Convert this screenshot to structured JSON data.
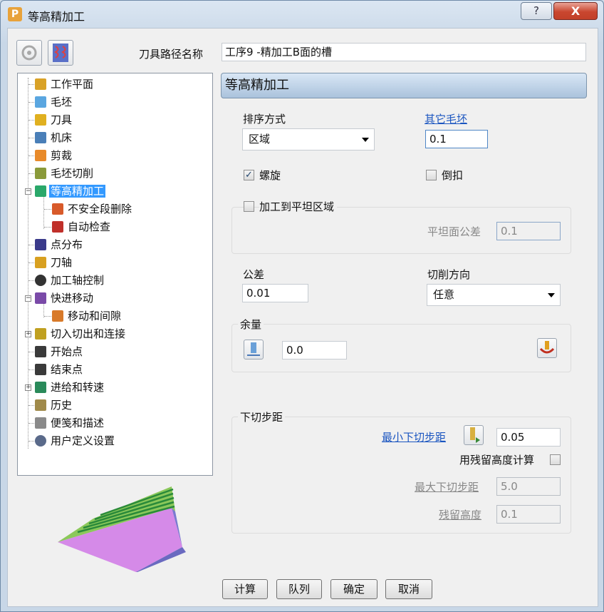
{
  "window": {
    "title": "等高精加工",
    "help": "?",
    "close": "X"
  },
  "header": {
    "path_name_label": "刀具路径名称",
    "path_name_value": "工序9 -精加工B面的槽"
  },
  "tree": {
    "items": [
      {
        "label": "工作平面",
        "color": "#d9a227"
      },
      {
        "label": "毛坯",
        "color": "#5aa6e0"
      },
      {
        "label": "刀具",
        "color": "#e0b020"
      },
      {
        "label": "机床",
        "color": "#4a7fb8"
      },
      {
        "label": "剪裁",
        "color": "#e88a2a"
      },
      {
        "label": "毛坯切削",
        "color": "#8a9a3a"
      },
      {
        "label": "等高精加工",
        "color": "#2aa86a"
      },
      {
        "label": "不安全段删除",
        "color": "#d85a2a"
      },
      {
        "label": "自动检查",
        "color": "#c0302a"
      },
      {
        "label": "点分布",
        "color": "#3a3a8a"
      },
      {
        "label": "刀轴",
        "color": "#d8a020"
      },
      {
        "label": "加工轴控制",
        "color": "#333333"
      },
      {
        "label": "快进移动",
        "color": "#7a4aa8"
      },
      {
        "label": "移动和间隙",
        "color": "#d87a2a"
      },
      {
        "label": "切入切出和连接",
        "color": "#c0a020"
      },
      {
        "label": "开始点",
        "color": "#3a3a3a"
      },
      {
        "label": "结束点",
        "color": "#3a3a3a"
      },
      {
        "label": "进给和转速",
        "color": "#2a8a5a"
      },
      {
        "label": "历史",
        "color": "#a08a4a"
      },
      {
        "label": "便笺和描述",
        "color": "#8a8a8a"
      },
      {
        "label": "用户定义设置",
        "color": "#5a6a8a"
      }
    ],
    "selected": "等高精加工"
  },
  "panel": {
    "title": "等高精加工",
    "ordering_label": "排序方式",
    "ordering_value": "区域",
    "other_stock_label": "其它毛坯",
    "other_stock_value": "0.1",
    "spiral_label": "螺旋",
    "spiral_checked": "✓",
    "undercut_label": "倒扣",
    "flat_area_label": "加工到平坦区域",
    "flat_tolerance_label": "平坦面公差",
    "flat_tolerance_value": "0.1",
    "tolerance_label": "公差",
    "tolerance_value": "0.01",
    "cut_direction_label": "切削方向",
    "cut_direction_value": "任意",
    "allowance_label": "余量",
    "allowance_value": "0.0",
    "stepdown_label": "下切步距",
    "min_stepdown_label": "最小下切步距",
    "min_stepdown_value": "0.05",
    "cusp_calc_label": "用残留高度计算",
    "max_stepdown_label": "最大下切步距",
    "max_stepdown_value": "5.0",
    "cusp_height_label": "残留高度",
    "cusp_height_value": "0.1"
  },
  "buttons": {
    "calculate": "计算",
    "queue": "队列",
    "ok": "确定",
    "cancel": "取消"
  }
}
